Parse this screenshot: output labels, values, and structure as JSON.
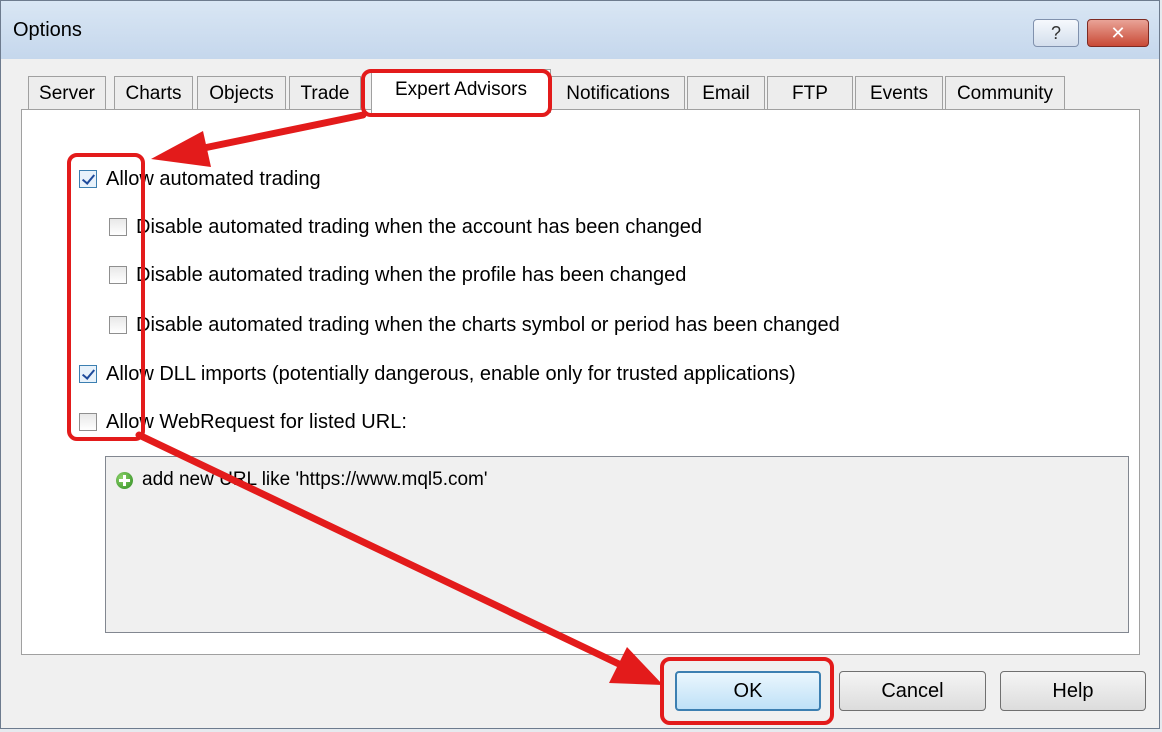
{
  "window": {
    "title": "Options"
  },
  "title_buttons": {
    "help": "?",
    "close": "✕"
  },
  "tabs": [
    {
      "label": "Server"
    },
    {
      "label": "Charts"
    },
    {
      "label": "Objects"
    },
    {
      "label": "Trade"
    },
    {
      "label": "Expert Advisors",
      "active": true
    },
    {
      "label": "Notifications"
    },
    {
      "label": "Email"
    },
    {
      "label": "FTP"
    },
    {
      "label": "Events"
    },
    {
      "label": "Community"
    }
  ],
  "options": [
    {
      "label": "Allow automated trading",
      "checked": true
    },
    {
      "label": "Disable automated trading when the account has been changed",
      "checked": false
    },
    {
      "label": "Disable automated trading when the profile has been changed",
      "checked": false
    },
    {
      "label": "Disable automated trading when the charts symbol or period has been changed",
      "checked": false
    },
    {
      "label": "Allow DLL imports (potentially dangerous, enable only for trusted applications)",
      "checked": true
    },
    {
      "label": "Allow WebRequest for listed URL:",
      "checked": false
    }
  ],
  "url_list": {
    "add_text": "add new URL like 'https://www.mql5.com'",
    "icon": "plus-circle-icon"
  },
  "buttons": {
    "ok": "OK",
    "cancel": "Cancel",
    "help": "Help"
  },
  "annotation_color": "#e31b1b"
}
